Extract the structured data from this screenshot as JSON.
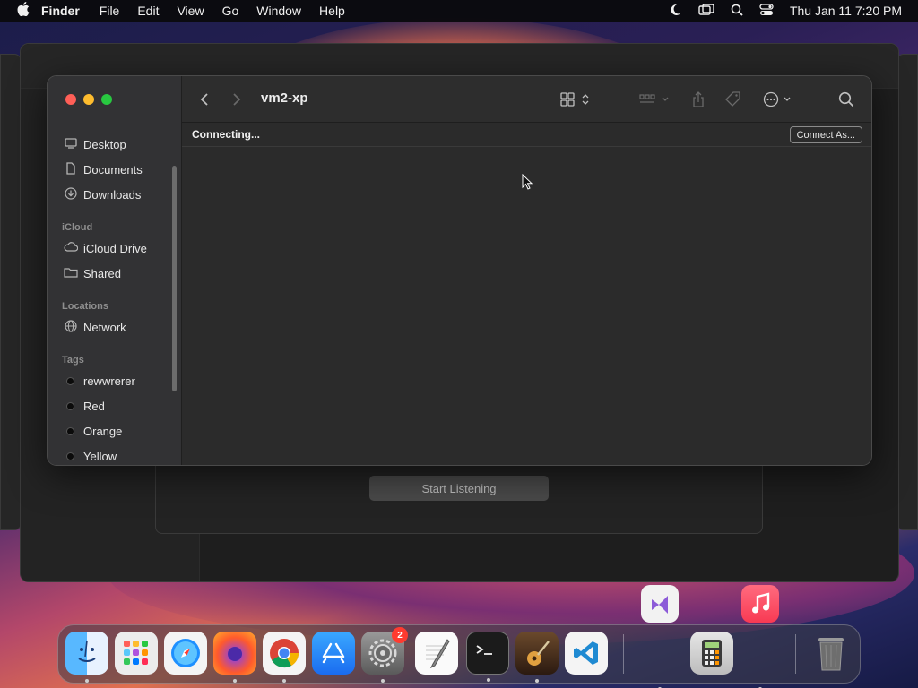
{
  "menubar": {
    "app": "Finder",
    "items": [
      "File",
      "Edit",
      "View",
      "Go",
      "Window",
      "Help"
    ],
    "clock": "Thu Jan 11  7:20 PM"
  },
  "finder": {
    "title": "vm2-xp",
    "status": "Connecting...",
    "connect_label": "Connect As...",
    "sidebar": {
      "favorites": [
        {
          "label": "Desktop",
          "icon": "desktop-icon"
        },
        {
          "label": "Documents",
          "icon": "document-icon"
        },
        {
          "label": "Downloads",
          "icon": "download-icon"
        }
      ],
      "icloud_header": "iCloud",
      "icloud": [
        {
          "label": "iCloud Drive",
          "icon": "cloud-icon"
        },
        {
          "label": "Shared",
          "icon": "shared-folder-icon"
        }
      ],
      "locations_header": "Locations",
      "locations": [
        {
          "label": "Network",
          "icon": "globe-icon"
        }
      ],
      "tags_header": "Tags",
      "tags": [
        {
          "label": "rewwrerer",
          "color": "#0b0b0b"
        },
        {
          "label": "Red",
          "color": "#0b0b0b"
        },
        {
          "label": "Orange",
          "color": "#0b0b0b"
        },
        {
          "label": "Yellow",
          "color": "#0b0b0b"
        }
      ]
    }
  },
  "background": {
    "listen_label": "Start Listening"
  },
  "dock": {
    "settings_badge": "2",
    "apps": [
      "Finder",
      "Launchpad",
      "Safari",
      "Firefox",
      "Chrome",
      "App Store",
      "System Settings",
      "TextEdit",
      "Terminal",
      "GarageBand",
      "Visual Studio Code",
      "Calculator",
      "Trash"
    ],
    "floating": [
      "Visual Studio",
      "Music"
    ]
  }
}
